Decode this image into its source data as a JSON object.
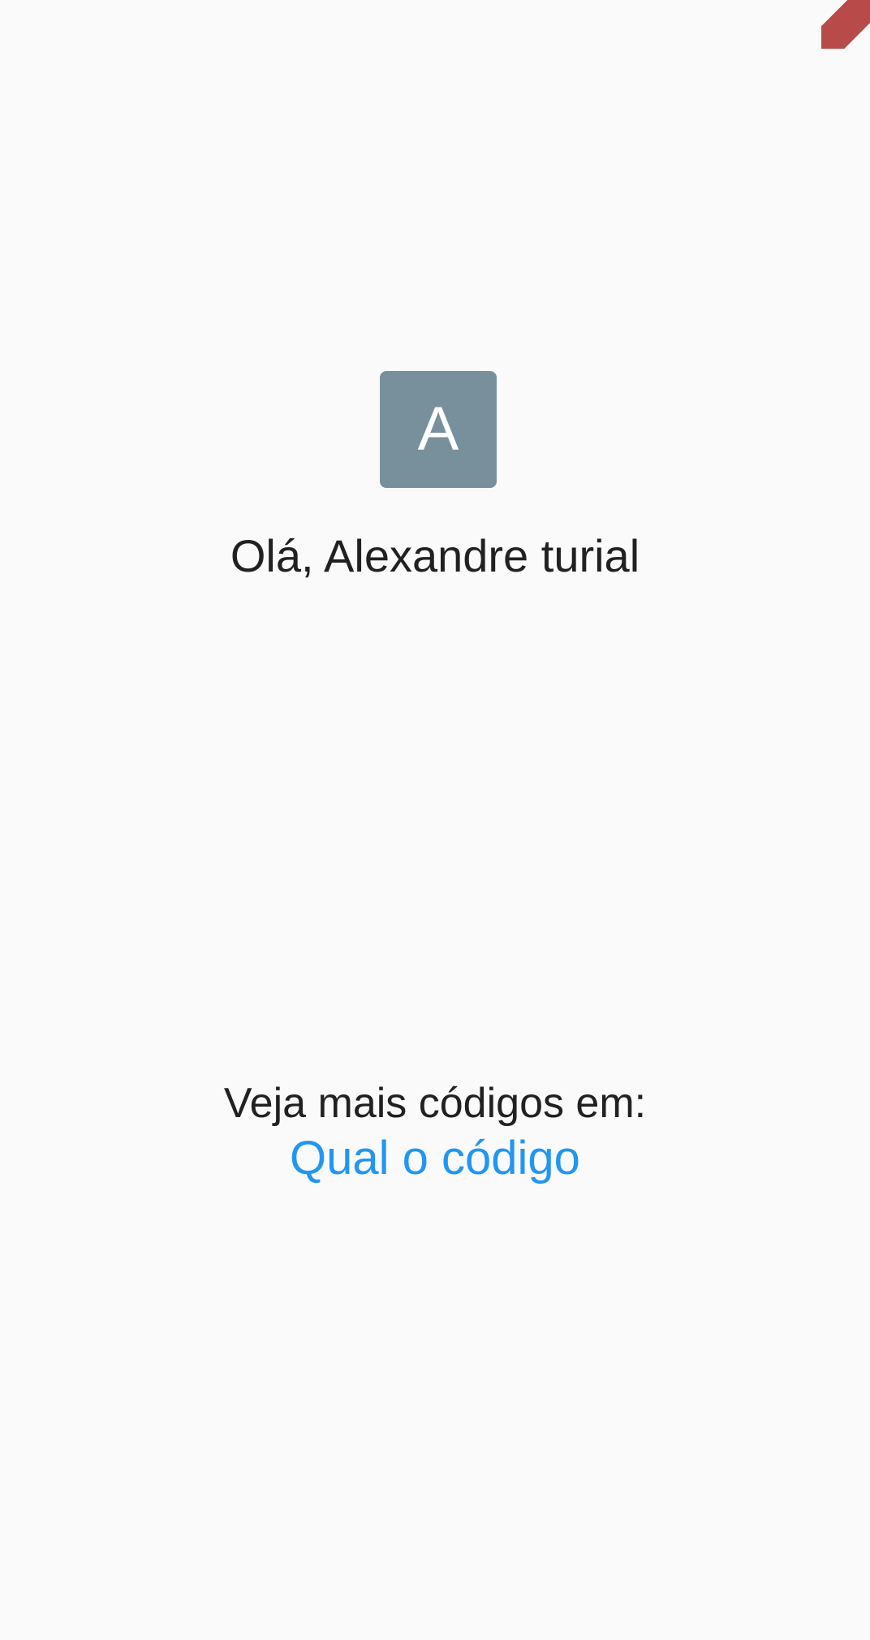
{
  "profile": {
    "avatar_initial": "A",
    "greeting": "Olá, Alexandre turial"
  },
  "footer": {
    "caption": "Veja mais códigos em:",
    "link_text": "Qual o código"
  },
  "colors": {
    "background": "#fafafa",
    "avatar_background": "#78909c",
    "text_primary": "#212121",
    "link": "#2196f3",
    "debug_banner": "#b84a4a"
  }
}
